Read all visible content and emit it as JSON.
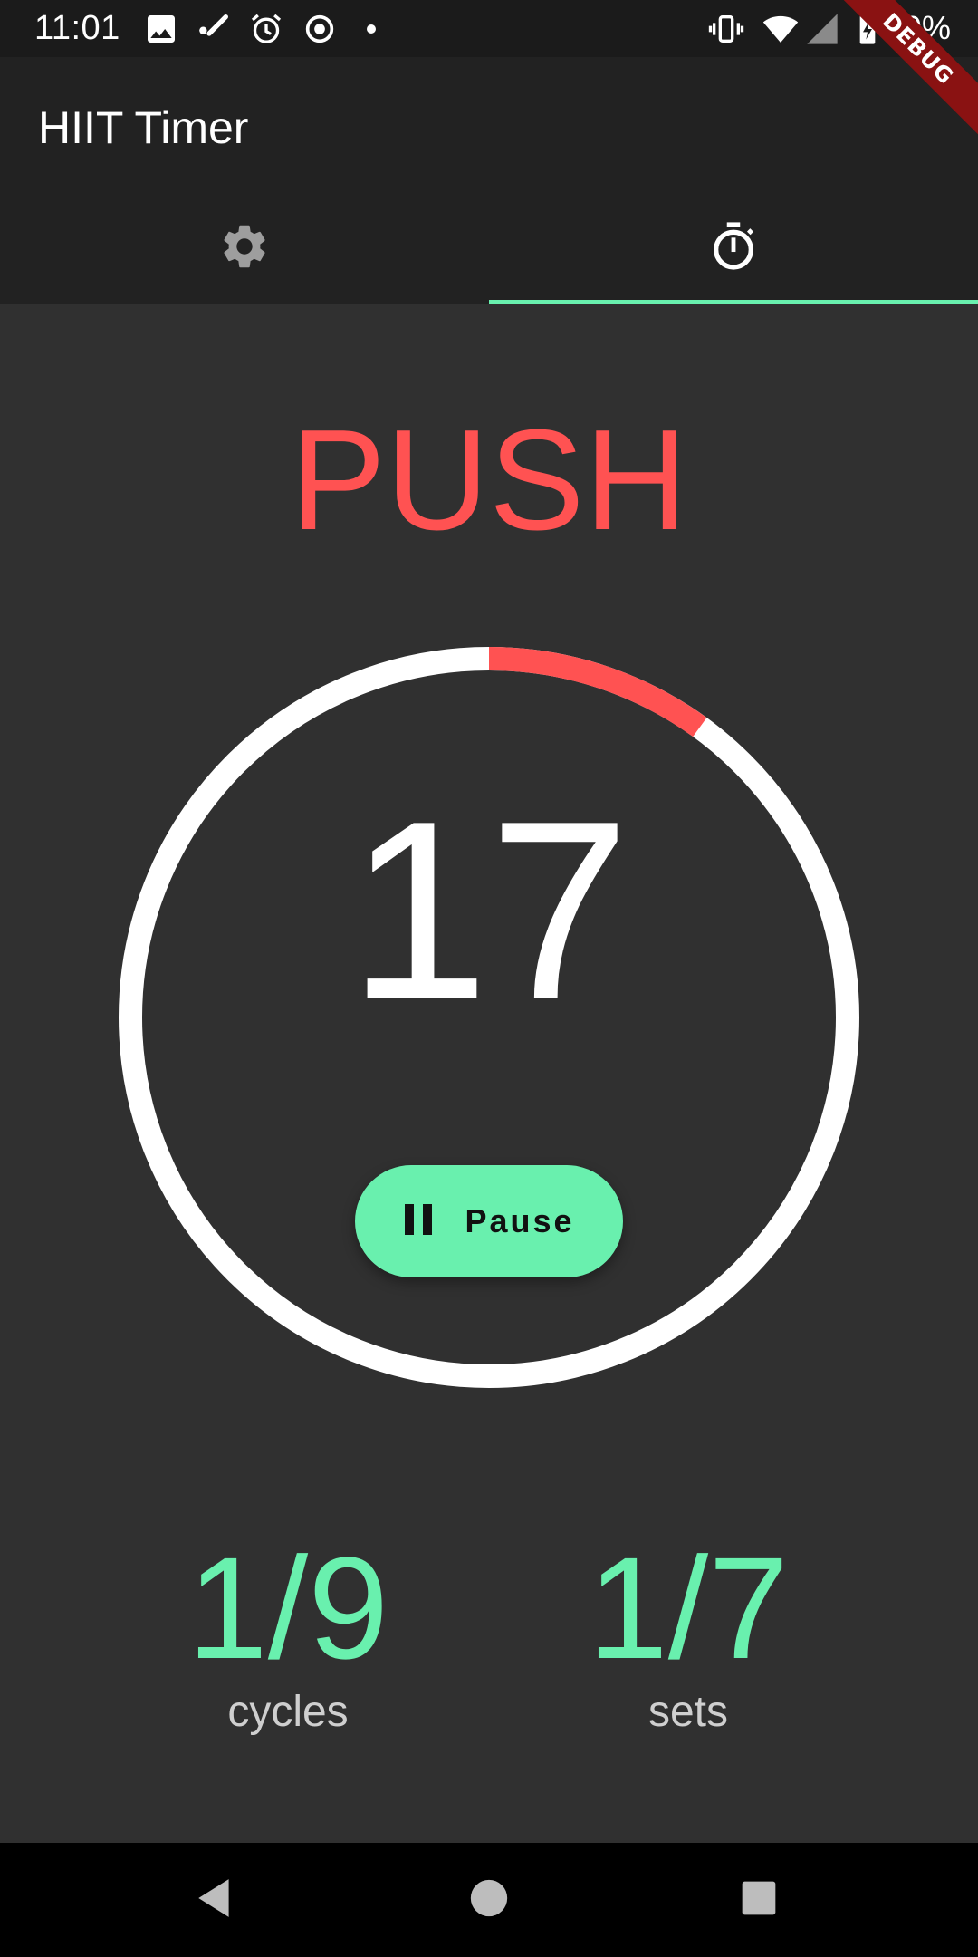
{
  "status_bar": {
    "time": "11:01",
    "battery": "79%",
    "icons": [
      "image-icon",
      "pen-icon",
      "alarm-icon",
      "record-icon",
      "dot-icon",
      "vibrate-icon",
      "wifi-icon",
      "signal-icon",
      "battery-charging-icon"
    ]
  },
  "debug_banner": "DEBUG",
  "app_bar": {
    "title": "HIIT Timer",
    "tabs": [
      {
        "icon": "gear-icon",
        "selected": false
      },
      {
        "icon": "stopwatch-icon",
        "selected": true
      }
    ]
  },
  "workout": {
    "phase": "PUSH",
    "countdown": "17",
    "progress": 0.1,
    "pause_label": "Pause",
    "cycles_value": "1/9",
    "cycles_label": "cycles",
    "sets_value": "1/7",
    "sets_label": "sets"
  },
  "nav_bar": {
    "buttons": [
      "back-icon",
      "home-icon",
      "recents-icon"
    ]
  },
  "colors": {
    "accent": "#69f0ae",
    "phase": "#ff5252",
    "background": "#303030",
    "app_bar": "#222222"
  }
}
